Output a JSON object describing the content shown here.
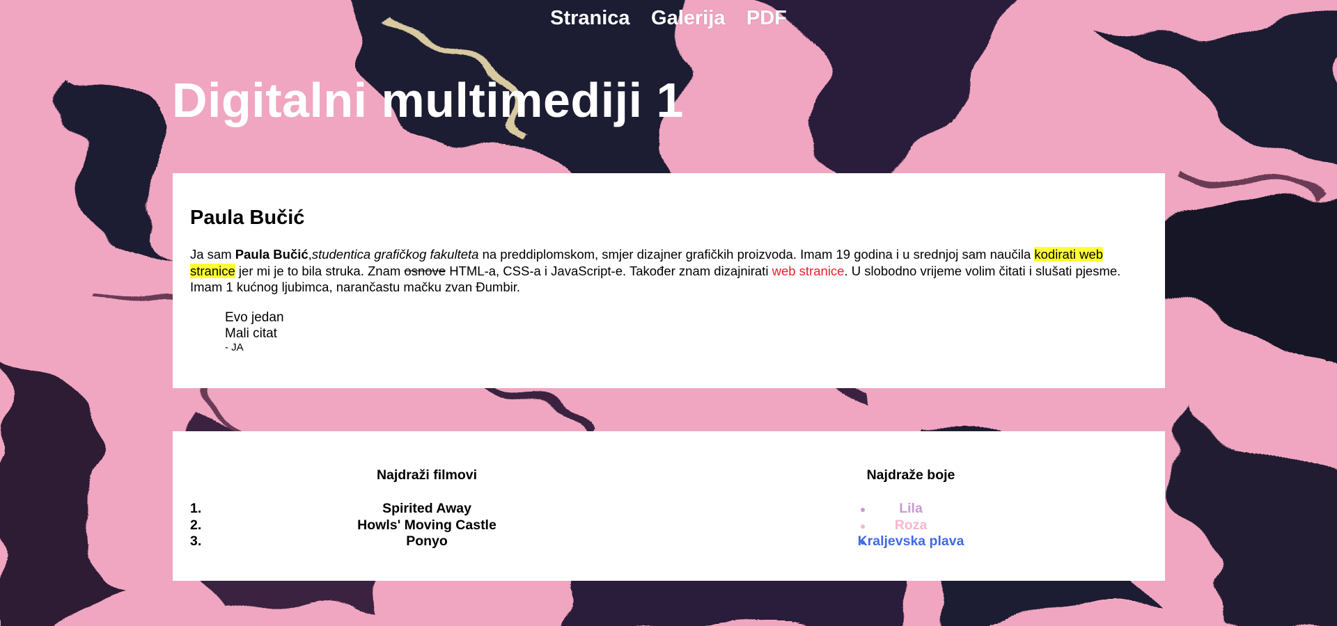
{
  "nav": {
    "links": [
      "Stranica",
      "Galerija",
      "PDF"
    ]
  },
  "site_title": "Digitalni multimediji 1",
  "about": {
    "name": "Paula Bučić",
    "bio": {
      "p1": "Ja sam ",
      "bold_name": "Paula Bučić",
      "p2": ",",
      "italic_role": "studentica grafičkog fakulteta",
      "p3": " na preddiplomskom, smjer dizajner grafičkih proizvoda. Imam 19 godina i u srednjoj sam naučila ",
      "highlight": "kodirati web stranice",
      "p4": " jer mi je to bila struka. Znam ",
      "strike": "osnove",
      "p5": " HTML-a, CSS-a i JavaScript-e. Također znam dizajnirati ",
      "red_link": "web stranice",
      "p6": ". U slobodno vrijeme volim čitati i slušati pjesme. Imam 1 kućnog ljubimca, narančastu mačku zvan Đumbir."
    },
    "quote": {
      "line1": "Evo jedan",
      "line2": "Mali citat",
      "author": "- JA"
    }
  },
  "favorites": {
    "movies": {
      "title": "Najdraži filmovi",
      "items": [
        {
          "num": "1.",
          "label": "Spirited Away"
        },
        {
          "num": "2.",
          "label": "Howls' Moving Castle"
        },
        {
          "num": "3.",
          "label": "Ponyo"
        }
      ]
    },
    "colors": {
      "title": "Najdraže boje",
      "items": [
        {
          "label": "Lila",
          "color": "#c79bd0"
        },
        {
          "label": "Roza",
          "color": "#f7b6cb"
        },
        {
          "label": "Kraljevska plava",
          "color": "#4169e1"
        }
      ]
    }
  },
  "theme": {
    "background_pink": "#f0a6c0",
    "background_dark": "#1b1a33",
    "highlight": "#ffff33",
    "red": "#e8202a"
  }
}
